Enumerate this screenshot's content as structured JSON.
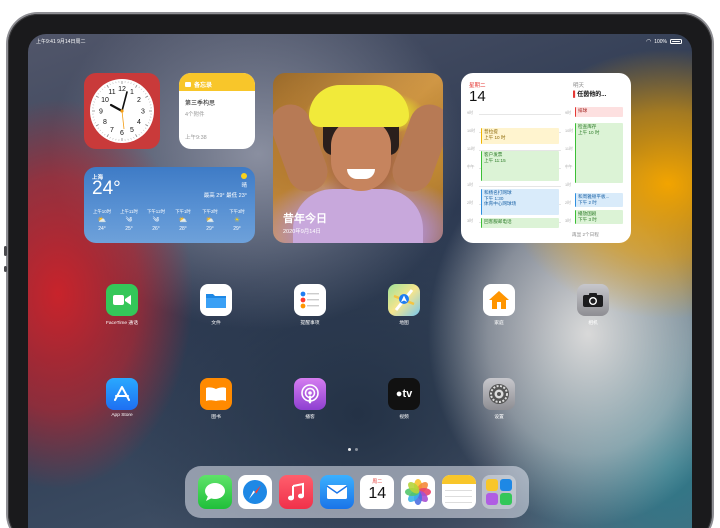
{
  "status_bar": {
    "time_date": "上午9:41  9月14日周二",
    "battery": "100%"
  },
  "notes_widget": {
    "header": "备忘录",
    "title": "第三季构思",
    "subtitle": "4个附件",
    "time": "上午9:38"
  },
  "clock_widget": {
    "numerals": [
      "12",
      "1",
      "2",
      "3",
      "4",
      "5",
      "6",
      "7",
      "8",
      "9",
      "10",
      "11"
    ]
  },
  "photo_widget": {
    "title": "昔年今日",
    "date": "2020年9月14日"
  },
  "weather_widget": {
    "city": "上海",
    "temp": "24°",
    "condition": "晴",
    "hi_lo": "最高 29° 最低 23°",
    "hours": [
      {
        "time": "上午10时",
        "icon": "partly-cloudy-icon",
        "glyph": "⛅",
        "temp": "24°"
      },
      {
        "time": "上午11时",
        "icon": "wind-icon",
        "glyph": "༄",
        "temp": "25°"
      },
      {
        "time": "下午12时",
        "icon": "wind-icon",
        "glyph": "༄",
        "temp": "26°"
      },
      {
        "time": "下午1时",
        "icon": "partly-cloudy-icon",
        "glyph": "⛅",
        "temp": "28°"
      },
      {
        "time": "下午2时",
        "icon": "partly-cloudy-icon",
        "glyph": "⛅",
        "temp": "29°"
      },
      {
        "time": "下午3时",
        "icon": "sun-icon",
        "glyph": "☀",
        "temp": "29°"
      }
    ]
  },
  "calendar_widget": {
    "weekday": "星期二",
    "date": "14",
    "tomorrow_label": "明天",
    "tomorrow_event": "任茵他的...",
    "hours_left": [
      "9时",
      "10时",
      "11时",
      "中午",
      "1时",
      "2时",
      "3时"
    ],
    "hours_right": [
      "9时",
      "10时",
      "11时",
      "中午",
      "1时",
      "2时",
      "3时"
    ],
    "events_left": [
      {
        "title": "普拉提",
        "time": "上午 10 时"
      },
      {
        "title": "客户发票",
        "time": "上午 11:15"
      },
      {
        "title": "和杨名打网球",
        "time": "下午 1:30",
        "extra": "体育中心网球场"
      },
      {
        "title": "回客服邮电话",
        "time": ""
      }
    ],
    "events_right": [
      {
        "title": "排球",
        "time": ""
      },
      {
        "title": "检查库存",
        "time": "上午 10 时"
      },
      {
        "title": "和周雅顿平板...",
        "time": "下午 2 时"
      },
      {
        "title": "播放国剧",
        "time": "下午 3 时"
      }
    ],
    "more": "再显 2个日程"
  },
  "apps_row1": [
    {
      "name": "facetime",
      "label": "FaceTime 通话"
    },
    {
      "name": "files",
      "label": "文件"
    },
    {
      "name": "reminders",
      "label": "提醒事项"
    },
    {
      "name": "maps",
      "label": "地图"
    },
    {
      "name": "home",
      "label": "家庭"
    },
    {
      "name": "camera",
      "label": "相机"
    }
  ],
  "apps_row2": [
    {
      "name": "app-store",
      "label": "App Store"
    },
    {
      "name": "books",
      "label": "图书"
    },
    {
      "name": "podcasts",
      "label": "播客"
    },
    {
      "name": "apple-tv",
      "label": "视频",
      "glyph": "tv"
    },
    {
      "name": "settings",
      "label": "设置"
    }
  ],
  "dock": {
    "apps": [
      "messages",
      "safari",
      "music",
      "mail",
      "calendar",
      "photos",
      "notes",
      "app-library"
    ],
    "calendar_weekday": "周二",
    "calendar_date": "14"
  },
  "page_dots": {
    "count": 2,
    "current": 1
  },
  "colors": {
    "facetime": "#34c759",
    "files": "#1e88e5",
    "reminders": "#ffffff",
    "maps": "#5bc36b",
    "home": "#ffffff",
    "camera": "#8e8e93",
    "appstore": "#1e7df2",
    "books": "#ff8a00",
    "podcasts": "#b05de3",
    "appletv": "#111111",
    "settings": "#8e8e93"
  }
}
